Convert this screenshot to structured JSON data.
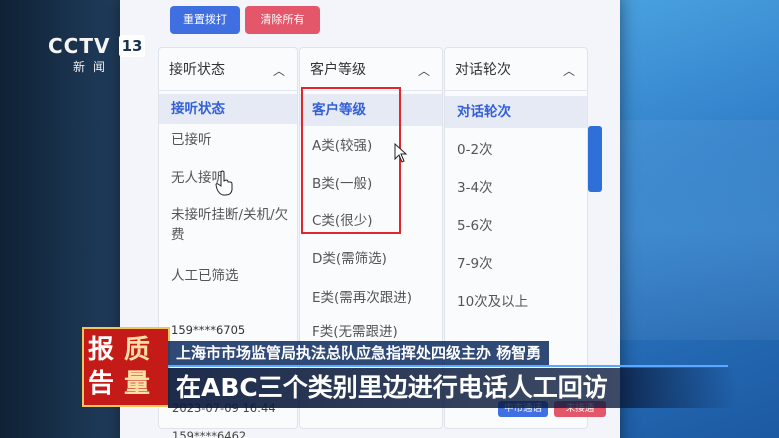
{
  "toolbar": {
    "reset_label": "重置拨打",
    "clear_label": "清除所有"
  },
  "filters": {
    "answer_status": {
      "header": "接听状态",
      "options": [
        "接听状态",
        "已接听",
        "无人接听",
        "未接听挂断/关机/欠费",
        "人工已筛选"
      ]
    },
    "customer_level": {
      "header": "客户等级",
      "options": [
        "客户等级",
        "A类(较强)",
        "B类(一般)",
        "C类(很少)",
        "D类(需筛选)",
        "E类(需再次跟进)",
        "F类(无需跟进)"
      ]
    },
    "dialog_rounds": {
      "header": "对话轮次",
      "options": [
        "对话轮次",
        "0-2次",
        "3-4次",
        "5-6次",
        "7-9次",
        "10次及以上"
      ]
    }
  },
  "records": [
    {
      "phone": "159****6705"
    },
    {
      "datetime": "2023-07-09 16:44",
      "tag_a": "中市通话",
      "tag_b": "未接通"
    },
    {
      "phone": "159****6462"
    }
  ],
  "broadcast": {
    "channel_logo": "CCTV",
    "channel_number": "13",
    "channel_sub": "新闻",
    "program_brand": [
      "报",
      "质",
      "告",
      "量"
    ],
    "speaker": "上海市市场监管局执法总队应急指挥处四级主办 杨智勇",
    "subtitle": "在ABC三个类别里边进行电话人工回访"
  },
  "colors": {
    "accent_blue": "#3f6fe0",
    "danger_red": "#e4576a",
    "highlight_red": "#e0282c",
    "selected_text": "#3360d8"
  }
}
